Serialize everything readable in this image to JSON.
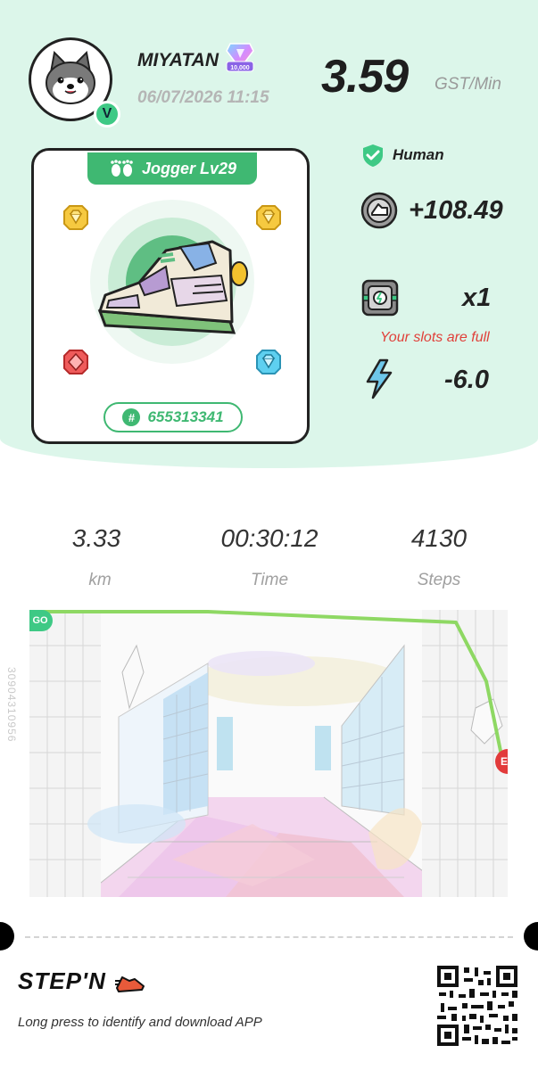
{
  "profile": {
    "username": "MIYATAN",
    "level_badge": "V",
    "rank_badge_text": "10,000",
    "datetime": "06/07/2026 11:15"
  },
  "earning_rate": {
    "value": "3.59",
    "unit": "GST/Min"
  },
  "sneaker": {
    "type_label": "Jogger Lv29",
    "id": "655313341",
    "id_prefix": "#"
  },
  "stats": {
    "verification": "Human",
    "gst_earned": "+108.49",
    "mystery_box_count": "x1",
    "slots_message": "Your slots are full",
    "energy_change": "-6.0"
  },
  "metrics": [
    {
      "value": "3.33",
      "label": "km"
    },
    {
      "value": "00:30:12",
      "label": "Time"
    },
    {
      "value": "4130",
      "label": "Steps"
    }
  ],
  "map": {
    "start_marker": "GO",
    "end_marker": "E",
    "side_code": "30904310956"
  },
  "footer": {
    "brand": "STEP'N",
    "tagline": "Long press to identify and download APP"
  },
  "colors": {
    "mint_background": "#dcf6ea",
    "accent_green": "#3fb872",
    "route_green": "#8ed863",
    "warning_red": "#e0403a"
  }
}
